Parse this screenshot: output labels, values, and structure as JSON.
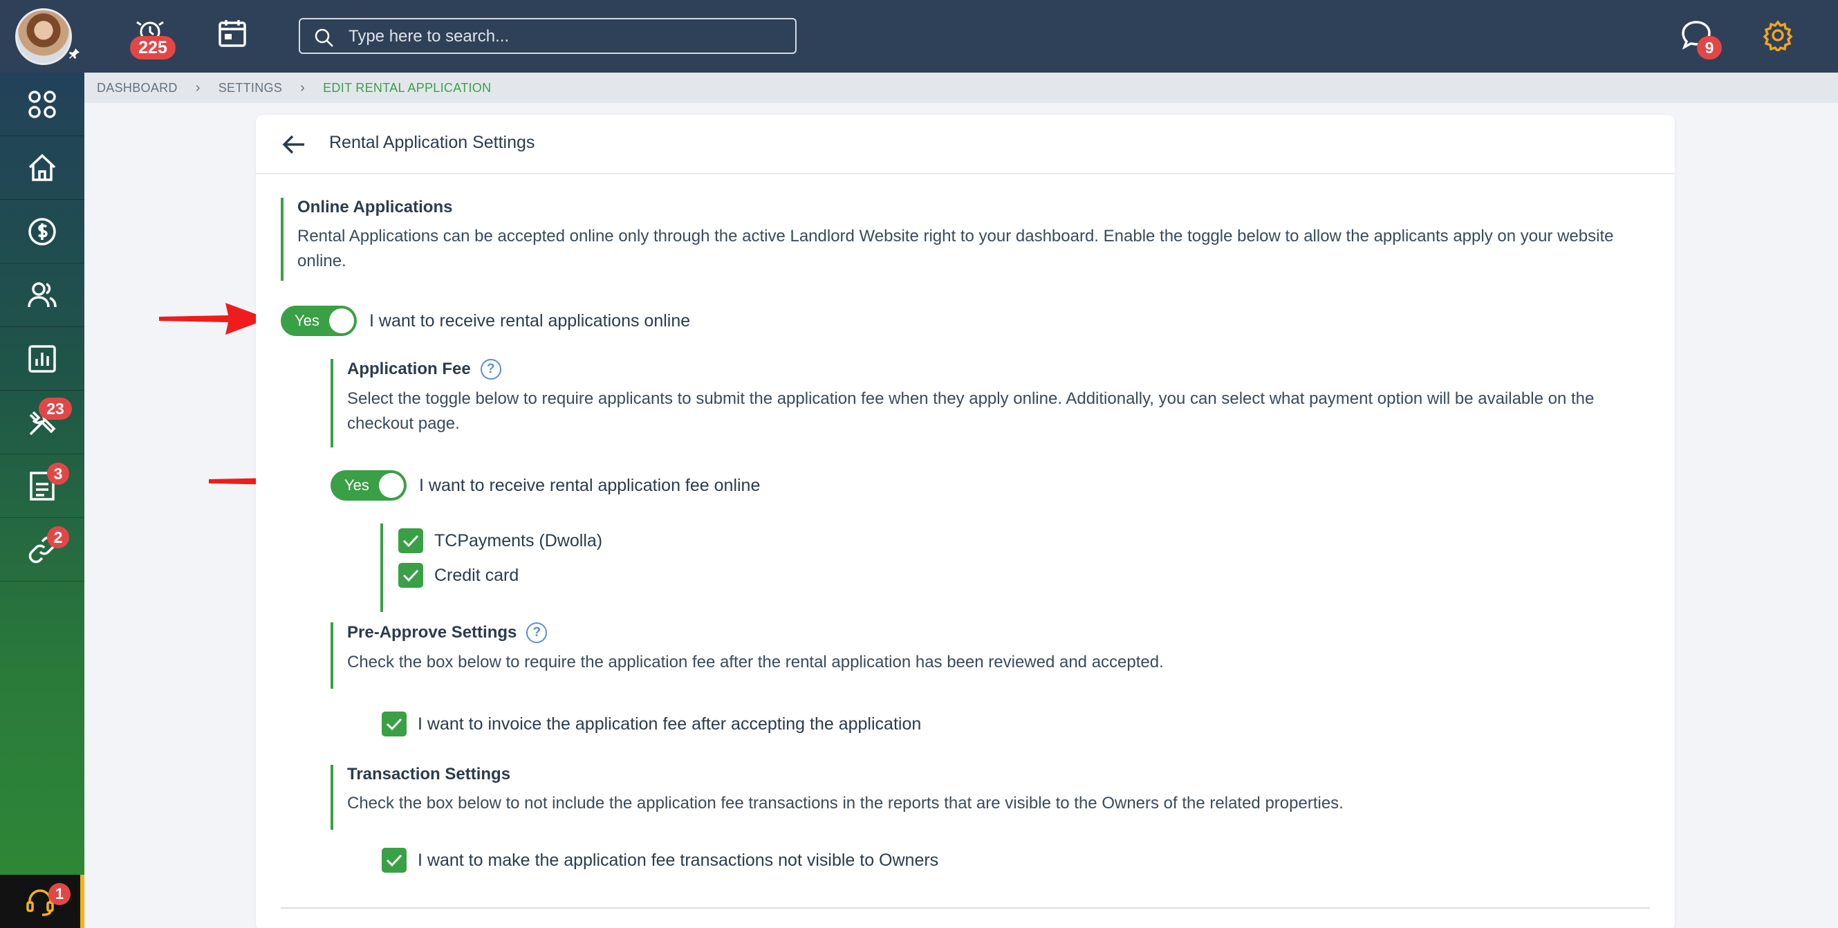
{
  "topbar": {
    "notifications_count": "225",
    "search_placeholder": "Type here to search...",
    "messages_count": "9"
  },
  "sidebar": {
    "items": [
      {
        "icon": "apps-icon"
      },
      {
        "icon": "home-icon"
      },
      {
        "icon": "dollar-icon"
      },
      {
        "icon": "people-icon"
      },
      {
        "icon": "chart-icon"
      },
      {
        "icon": "tools-icon",
        "badge": "23"
      },
      {
        "icon": "document-icon",
        "badge": "3"
      },
      {
        "icon": "link-icon",
        "badge": "2"
      }
    ],
    "support_badge": "1"
  },
  "breadcrumb": {
    "items": [
      "DASHBOARD",
      "SETTINGS",
      "EDIT RENTAL APPLICATION"
    ]
  },
  "card": {
    "title": "Rental Application Settings"
  },
  "online_applications": {
    "title": "Online Applications",
    "text": "Rental Applications can be accepted online only through the active Landlord Website right to your dashboard. Enable the toggle below to allow the applicants apply on your website online.",
    "toggle_label": "Yes",
    "toggle_text": "I want to receive rental applications online"
  },
  "application_fee": {
    "title": "Application Fee",
    "text": "Select the toggle below to require applicants to submit the application fee when they apply online. Additionally, you can select what payment option will be available on the checkout page.",
    "toggle_label": "Yes",
    "toggle_text": "I want to receive rental application fee online",
    "options": [
      "TCPayments (Dwolla)",
      "Credit card"
    ]
  },
  "pre_approve": {
    "title": "Pre-Approve Settings",
    "text": "Check the box below to require the application fee after the rental application has been reviewed and accepted.",
    "checkbox_text": "I want to invoice the application fee after accepting the application"
  },
  "transaction": {
    "title": "Transaction Settings",
    "text": "Check the box below to not include the application fee transactions in the reports that are visible to the Owners of the related properties.",
    "checkbox_text": "I want to make the application fee transactions not visible to Owners"
  },
  "colors": {
    "accent": "#3aa046",
    "topbar": "#2f4158",
    "badge": "#e24747",
    "annotation_arrow": "#ee1c1c"
  }
}
